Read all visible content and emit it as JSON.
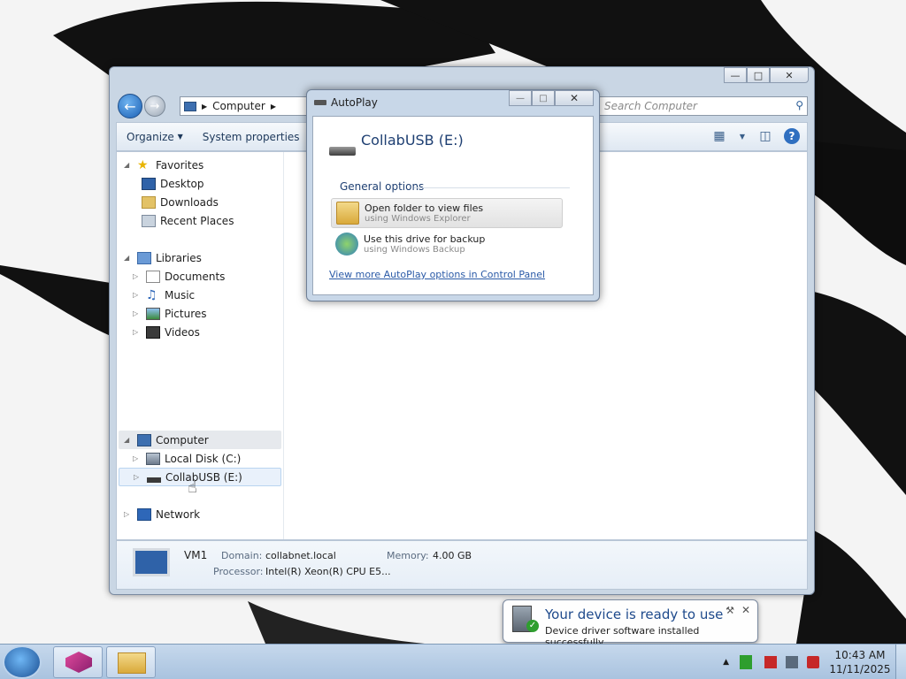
{
  "explorer": {
    "address": [
      "Computer"
    ],
    "search_placeholder": "Search Computer",
    "toolbar": {
      "organize": "Organize",
      "system_properties": "System properties"
    },
    "nav": {
      "favorites": "Favorites",
      "desktop": "Desktop",
      "downloads": "Downloads",
      "recent_places": "Recent Places",
      "libraries": "Libraries",
      "documents": "Documents",
      "music": "Music",
      "pictures": "Pictures",
      "videos": "Videos",
      "computer": "Computer",
      "local_disk": "Local Disk (C:)",
      "usb": "CollabUSB (E:)",
      "network": "Network"
    },
    "details": {
      "name": "VM1",
      "domain_label": "Domain:",
      "domain_value": "collabnet.local",
      "memory_label": "Memory:",
      "memory_value": "4.00 GB",
      "processor_label": "Processor:",
      "processor_value": "Intel(R) Xeon(R) CPU E5..."
    }
  },
  "autoplay": {
    "title": "AutoPlay",
    "device": "CollabUSB (E:)",
    "section": "General options",
    "options": [
      {
        "title": "Open folder to view files",
        "sub": "using Windows Explorer"
      },
      {
        "title": "Use this drive for backup",
        "sub": "using Windows Backup"
      }
    ],
    "control_panel_link": "View more AutoPlay options in Control Panel"
  },
  "notification": {
    "title": "Your device is ready to use",
    "body": "Device driver software installed successfully."
  },
  "taskbar": {
    "time": "10:43 AM",
    "date": "11/11/2025"
  }
}
